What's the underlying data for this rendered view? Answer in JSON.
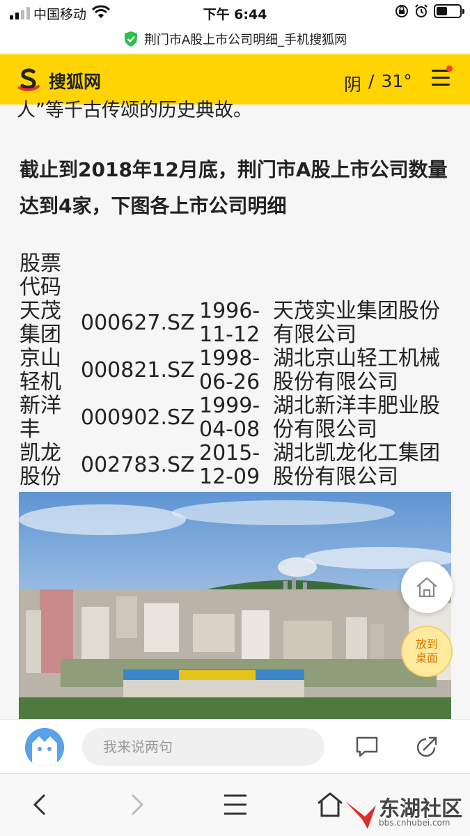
{
  "status_bar": {
    "carrier": "中国移动",
    "time": "下午 6:44"
  },
  "url_bar": {
    "title": "荆门市A股上市公司明细_手机搜狐网",
    "secure_color": "#2ebd4f"
  },
  "header": {
    "brand": "搜狐网",
    "weather": "阴",
    "separator": "/",
    "temperature": "31°",
    "brand_color": "#ffd400"
  },
  "article": {
    "cut_text": "人”等千古传颂的历史典故。",
    "headline": "截止到2018年12月底，荆门市A股上市公司数量达到4家，下图各上市公司明细",
    "table": {
      "header": [
        "股票代码"
      ],
      "rows": [
        {
          "name": "天茂集团",
          "code": "000627.SZ",
          "date": "1996-11-12",
          "full_name": "天茂实业集团股份有限公司"
        },
        {
          "name": "京山轻机",
          "code": "000821.SZ",
          "date": "1998-06-26",
          "full_name": "湖北京山轻工机械股份有限公司"
        },
        {
          "name": "新洋丰",
          "code": "000902.SZ",
          "date": "1999-04-08",
          "full_name": "湖北新洋丰肥业股份有限公司"
        },
        {
          "name": "凯龙股份",
          "code": "002783.SZ",
          "date": "2015-12-09",
          "full_name": "湖北凯龙化工集团股份有限公司"
        }
      ]
    }
  },
  "floating": {
    "desktop_label": "放到桌面"
  },
  "comment_bar": {
    "placeholder": "我来说两句"
  },
  "watermark": {
    "name": "东湖社区",
    "url": "bbs.cnhubei.com"
  }
}
